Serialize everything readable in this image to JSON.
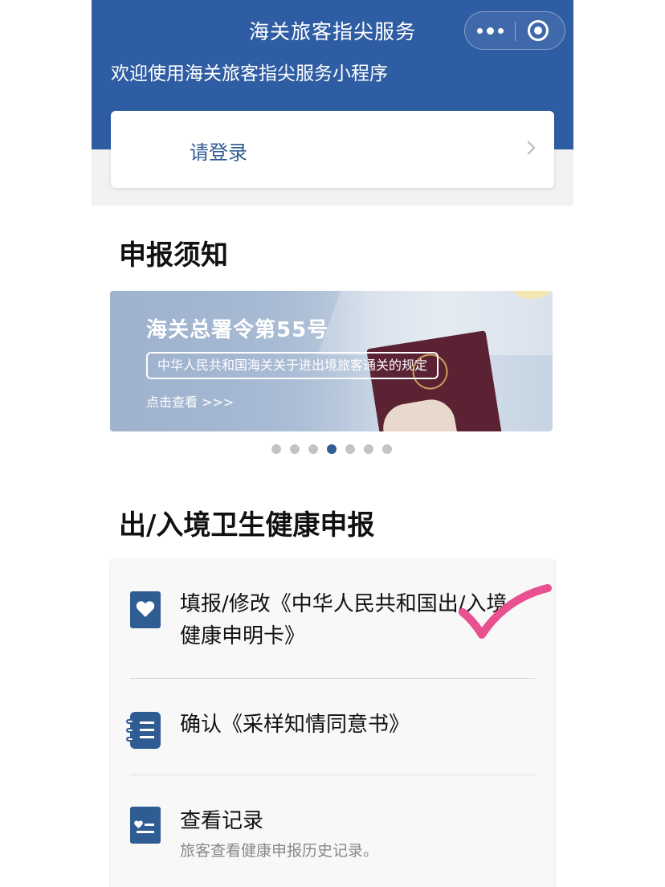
{
  "header": {
    "title": "海关旅客指尖服务",
    "welcome": "欢迎使用海关旅客指尖服务小程序"
  },
  "login": {
    "label": "请登录"
  },
  "notice": {
    "section_title": "申报须知",
    "banner": {
      "title": "海关总署令第55号",
      "subtitle": "中华人民共和国海关关于进出境旅客通关的规定",
      "link": "点击查看 >>>"
    },
    "carousel": {
      "count": 7,
      "active_index": 3
    }
  },
  "health": {
    "section_title": "出/入境卫生健康申报",
    "items": [
      {
        "label_line1": "填报/修改《中华人民共和国出/入境",
        "label_line2": "健康申明卡》",
        "icon": "heart-icon"
      },
      {
        "label": "确认《采样知情同意书》",
        "icon": "notebook-icon"
      },
      {
        "label": "查看记录",
        "sub": "旅客查看健康申报历史记录。",
        "icon": "record-icon"
      }
    ]
  },
  "colors": {
    "header_bg": "#2f5da3",
    "accent": "#2f5d93",
    "annotation": "#e8508f"
  }
}
